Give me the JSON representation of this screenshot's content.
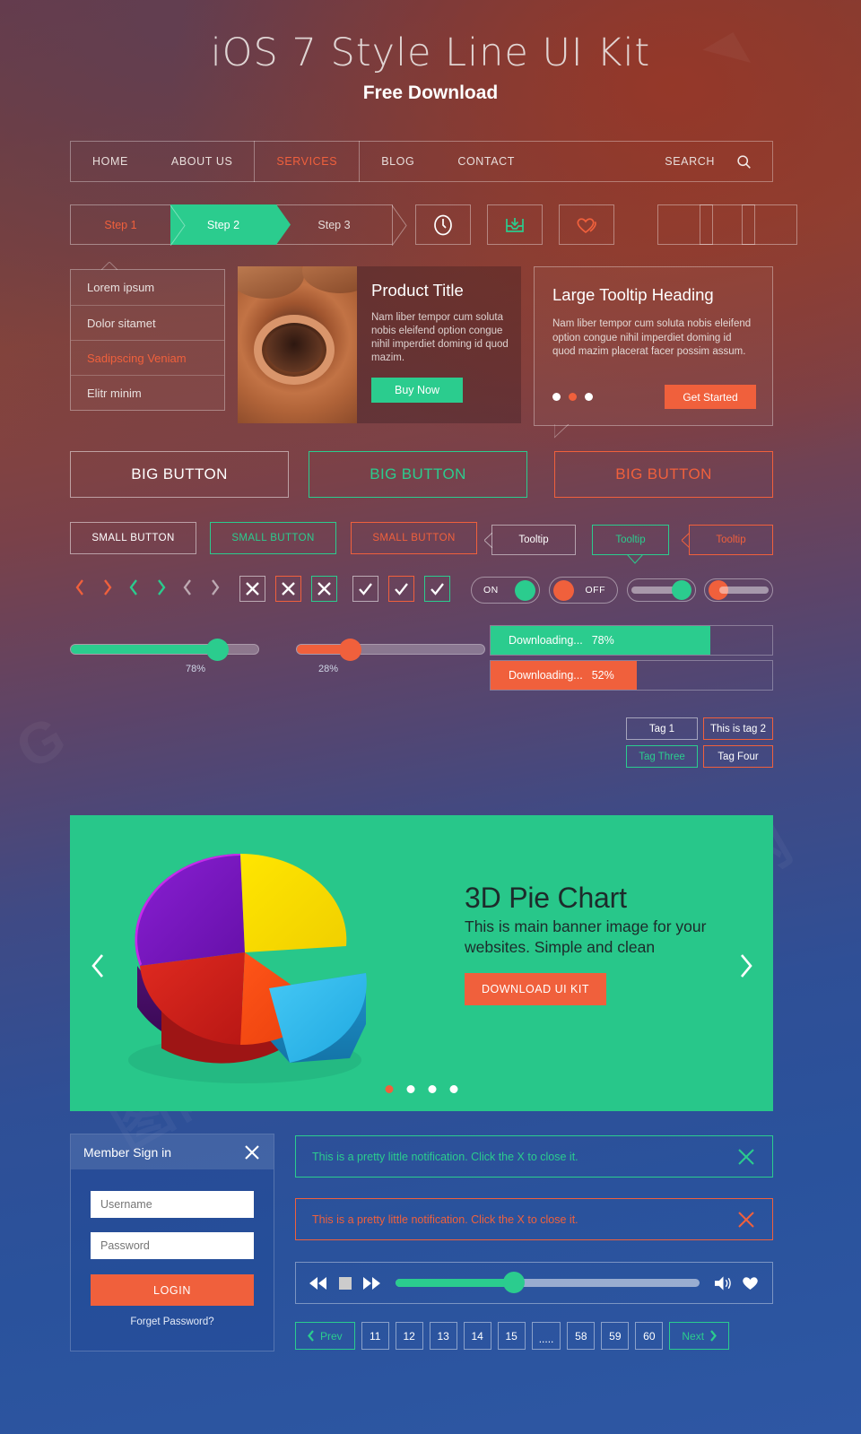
{
  "header": {
    "title": "iOS 7 Style Line UI Kit",
    "subtitle": "Free Download"
  },
  "nav": {
    "items": [
      {
        "label": "HOME",
        "active": false
      },
      {
        "label": "ABOUT US",
        "active": false
      },
      {
        "label": "SERVICES",
        "active": true
      },
      {
        "label": "BLOG",
        "active": false
      },
      {
        "label": "CONTACT",
        "active": false
      }
    ],
    "search_label": "SEARCH",
    "search_icon": "search-icon"
  },
  "steps": [
    {
      "label": "Step 1",
      "state": "done"
    },
    {
      "label": "Step 2",
      "state": "active"
    },
    {
      "label": "Step 3",
      "state": "todo"
    }
  ],
  "icon_buttons": [
    {
      "icon": "clock-icon",
      "color": "#ffffff"
    },
    {
      "icon": "inbox-download-icon",
      "color": "#2bcc8e"
    },
    {
      "icon": "heart-icon",
      "color": "#f0603c"
    },
    {
      "icon": "blank-icon",
      "color": "#ffffff"
    },
    {
      "icon": "list-icon",
      "color": "#ffffff"
    },
    {
      "icon": "menu-icon",
      "color": "#ffffff"
    }
  ],
  "list_card": {
    "items": [
      {
        "label": "Lorem ipsum",
        "accent": false
      },
      {
        "label": "Dolor sitamet",
        "accent": false
      },
      {
        "label": "Sadipscing Veniam",
        "accent": true
      },
      {
        "label": "Elitr minim",
        "accent": false
      }
    ]
  },
  "product": {
    "title": "Product Title",
    "body": "Nam liber tempor cum soluta nobis eleifend option congue nihil imperdiet doming id quod mazim.",
    "button": "Buy Now"
  },
  "tooltip_card": {
    "title": "Large Tooltip Heading",
    "body": "Nam liber tempor cum soluta nobis eleifend option congue nihil imperdiet doming id quod mazim placerat facer possim assum.",
    "button": "Get Started",
    "dots": 3,
    "active_dot": 1
  },
  "big_buttons": [
    {
      "label": "BIG BUTTON",
      "color": "#ffffff"
    },
    {
      "label": "BIG BUTTON",
      "color": "#2bcc8e"
    },
    {
      "label": "BIG BUTTON",
      "color": "#f0603c"
    }
  ],
  "small_buttons": [
    {
      "label": "SMALL BUTTON",
      "color": "#ffffff"
    },
    {
      "label": "SMALL BUTTON",
      "color": "#2bcc8e"
    },
    {
      "label": "SMALL BUTTON",
      "color": "#f0603c"
    }
  ],
  "tooltips": [
    {
      "label": "Tooltip",
      "color": "#ffffff"
    },
    {
      "label": "Tooltip",
      "color": "#2bcc8e"
    },
    {
      "label": "Tooltip",
      "color": "#f0603c"
    }
  ],
  "toggles": [
    {
      "label": "ON",
      "state": "on",
      "color": "#2bcc8e"
    },
    {
      "label": "OFF",
      "state": "off",
      "color": "#f0603c"
    }
  ],
  "sliders_small": [
    {
      "color": "#2bcc8e",
      "position": "right"
    },
    {
      "color": "#f0603c",
      "position": "left"
    }
  ],
  "range_sliders": [
    {
      "value": "78%",
      "percent": 78,
      "color": "#2bcc8e"
    },
    {
      "value": "28%",
      "percent": 28,
      "color": "#f0603c"
    }
  ],
  "progress": [
    {
      "label": "Downloading...",
      "value": "78%",
      "percent": 78,
      "color": "#2bcc8e"
    },
    {
      "label": "Downloading...",
      "value": "52%",
      "percent": 52,
      "color": "#f0603c"
    }
  ],
  "tags": [
    {
      "label": "Tag 1",
      "color": "#ffffff"
    },
    {
      "label": "This is tag 2",
      "color": "#f0603c"
    },
    {
      "label": "Tag Three",
      "color": "#2bcc8e"
    },
    {
      "label": "Tag Four",
      "color": "#f0603c"
    }
  ],
  "banner": {
    "title": "3D Pie Chart",
    "body": "This is main banner image for your websites. Simple and clean",
    "button": "DOWNLOAD UI KIT",
    "background": "#28c78a",
    "prev_icon": "chevron-left-icon",
    "next_icon": "chevron-right-icon",
    "dots": 4,
    "active_dot": 0
  },
  "chart_data": {
    "type": "pie",
    "title": "3D Pie Chart",
    "labels": [
      "Yellow",
      "Purple",
      "Red",
      "Orange",
      "Cyan"
    ],
    "values": [
      22,
      20,
      20,
      13,
      25
    ],
    "colors": [
      "#f4e211",
      "#7b18c7",
      "#d32222",
      "#f4481a",
      "#2bb8e8"
    ],
    "exploded": [
      "Cyan"
    ],
    "legend": "none",
    "grid": false
  },
  "login": {
    "title": "Member Sign in",
    "close_icon": "close-icon",
    "username_placeholder": "Username",
    "password_placeholder": "Password",
    "button": "LOGIN",
    "forgot": "Forget Password?"
  },
  "notifications": [
    {
      "message": "This is a pretty little notification. Click the X to close it.",
      "color": "#2bcc8e"
    },
    {
      "message": "This is a pretty little notification. Click the X to close it.",
      "color": "#f0603c"
    }
  ],
  "player": {
    "rewind_icon": "rewind-icon",
    "stop_icon": "stop-icon",
    "forward_icon": "fast-forward-icon",
    "volume_icon": "volume-icon",
    "heart_icon": "heart-icon",
    "percent": 39,
    "color": "#2bcc8e"
  },
  "pagination": {
    "prev": "Prev",
    "next": "Next",
    "pages": [
      "11",
      "12",
      "13",
      "14",
      "15",
      ".....",
      "58",
      "59",
      "60"
    ]
  }
}
